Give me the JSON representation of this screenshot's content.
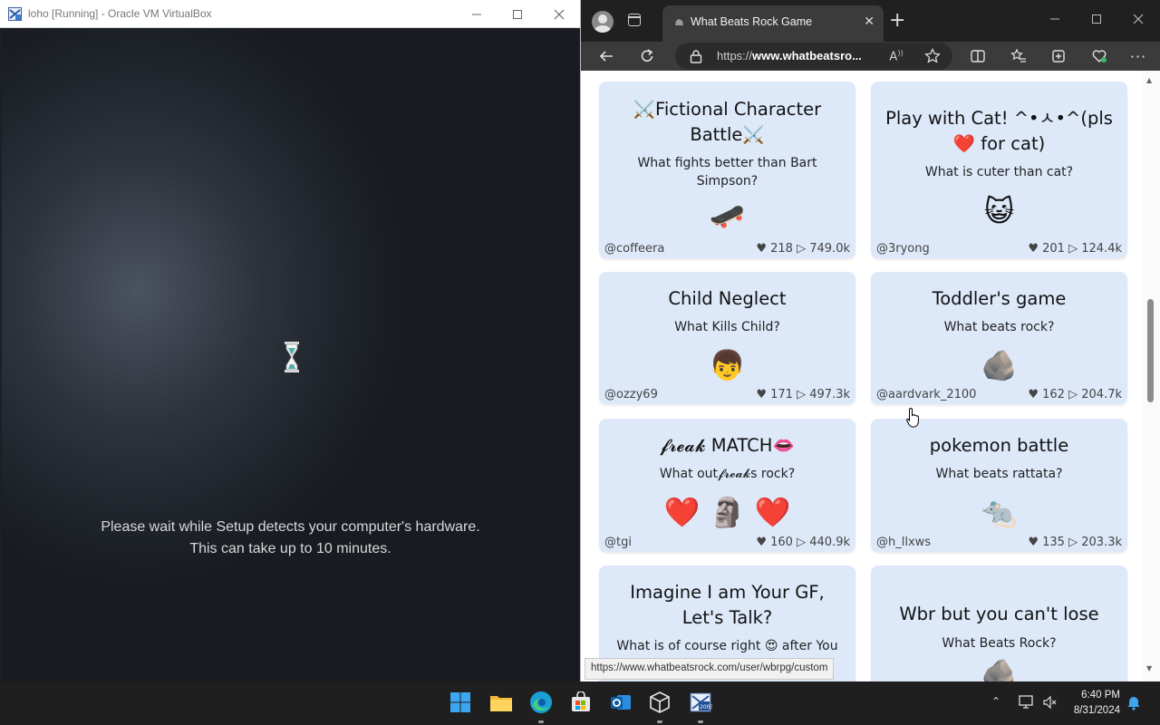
{
  "vbox": {
    "title": "loho [Running] - Oracle VM VirtualBox",
    "setup_line1": "Please wait while Setup detects your computer's hardware.",
    "setup_line2": "This can take up to 10 minutes."
  },
  "edge": {
    "tab_title": "What Beats Rock Game",
    "url_prefix": "https://",
    "url_domain": "www.whatbeatsro...",
    "status_url": "https://www.whatbeatsrock.com/user/wbrpg/custom"
  },
  "cards": [
    {
      "title": "⚔️Fictional Character Battle⚔️",
      "subtitle": "What fights better than Bart Simpson?",
      "emoji": "🛹",
      "author": "@coffeera",
      "likes": "218",
      "plays": "749.0k"
    },
    {
      "title": "Play with Cat! ^•ㅅ•^(pls ❤️ for cat)",
      "subtitle": "What is cuter than cat?",
      "emoji": "😺",
      "author": "@3ryong",
      "likes": "201",
      "plays": "124.4k"
    },
    {
      "title": "Child Neglect",
      "subtitle": "What Kills Child?",
      "emoji": "👦",
      "author": "@ozzy69",
      "likes": "171",
      "plays": "497.3k"
    },
    {
      "title": "Toddler's game",
      "subtitle": "What beats rock?",
      "emoji": "🪨",
      "author": "@aardvark_2100",
      "likes": "162",
      "plays": "204.7k"
    },
    {
      "title": "𝓯𝓻𝓮𝓪𝓴 MATCH👄",
      "subtitle": "What out𝓯𝓻𝓮𝓪𝓴s rock?",
      "emoji": "❤️ 🗿 ❤️",
      "author": "@tgi",
      "likes": "160",
      "plays": "440.9k"
    },
    {
      "title": "pokemon battle",
      "subtitle": "What beats rattata?",
      "emoji": "🐀",
      "author": "@h_llxws",
      "likes": "135",
      "plays": "203.3k"
    },
    {
      "title": "Imagine I am Your GF, Let's Talk?",
      "subtitle": "What is of course right 😍 after You",
      "emoji": "",
      "author": "",
      "likes": "",
      "plays": ""
    },
    {
      "title": "Wbr but you can't lose",
      "subtitle": "What Beats Rock?",
      "emoji": "🪨",
      "author": "",
      "likes": "",
      "plays": ""
    }
  ],
  "stat_icons": {
    "like": "heart-icon",
    "play": "play-icon"
  },
  "taskbar": {
    "time": "6:40 PM",
    "date": "8/31/2024",
    "apps": [
      "start-icon",
      "file-explorer-icon",
      "edge-icon",
      "store-icon",
      "outlook-icon",
      "virtualbox-icon",
      "vm-window-icon"
    ]
  },
  "colors": {
    "card_bg": "#dde8f9",
    "edge_dark": "#202020",
    "vm_bg": "#1b1f26"
  }
}
